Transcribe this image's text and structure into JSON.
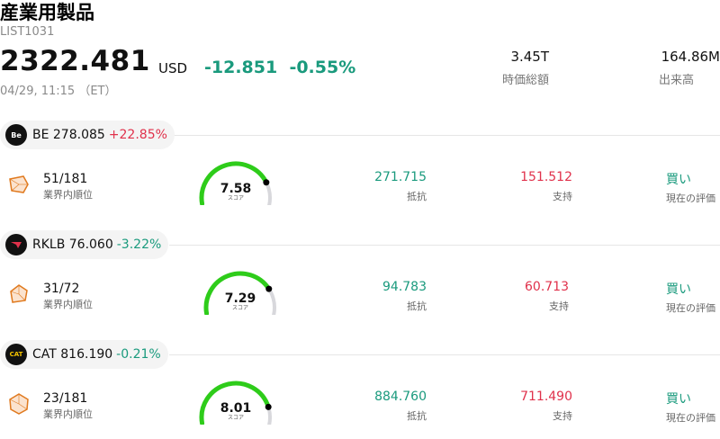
{
  "header": {
    "title": "産業用製品",
    "code": "LIST1031",
    "price": "2322.481",
    "currency": "USD",
    "change": "-12.851",
    "change_pct": "-0.55%",
    "timestamp": "04/29, 11:15 （ET）"
  },
  "stats": {
    "market_cap_value": "3.45T",
    "market_cap_label": "時価総額",
    "volume_value": "164.86M",
    "volume_label": "出来高"
  },
  "stocks": [
    {
      "ticker_price": "BE 278.085",
      "change_pct": "+22.85%",
      "direction": "up",
      "logo_icon": "bloom-energy-logo-icon",
      "rank": "51/181",
      "rank_label": "業界内順位",
      "score": "7.58",
      "score_label": "スコア",
      "score_value": 7.58,
      "resistance": "271.715",
      "resistance_label": "抵抗",
      "support": "151.512",
      "support_label": "支持",
      "rating": "買い",
      "rating_label": "現在の評価"
    },
    {
      "ticker_price": "RKLB 76.060",
      "change_pct": "-3.22%",
      "direction": "down",
      "logo_icon": "rocket-lab-logo-icon",
      "rank": "31/72",
      "rank_label": "業界内順位",
      "score": "7.29",
      "score_label": "スコア",
      "score_value": 7.29,
      "resistance": "94.783",
      "resistance_label": "抵抗",
      "support": "60.713",
      "support_label": "支持",
      "rating": "買い",
      "rating_label": "現在の評価"
    },
    {
      "ticker_price": "CAT 816.190",
      "change_pct": "-0.21%",
      "direction": "down",
      "logo_icon": "caterpillar-logo-icon",
      "rank": "23/181",
      "rank_label": "業界内順位",
      "score": "8.01",
      "score_label": "スコア",
      "score_value": 8.01,
      "resistance": "884.760",
      "resistance_label": "抵抗",
      "support": "711.490",
      "support_label": "支持",
      "rating": "買い",
      "rating_label": "現在の評価"
    }
  ],
  "colors": {
    "up": "#e0314b",
    "down": "#1a9a7d",
    "gauge_fill": "#2ecc1a",
    "gauge_track": "#d8d8dc",
    "radar_icon": "#e07a1f"
  }
}
